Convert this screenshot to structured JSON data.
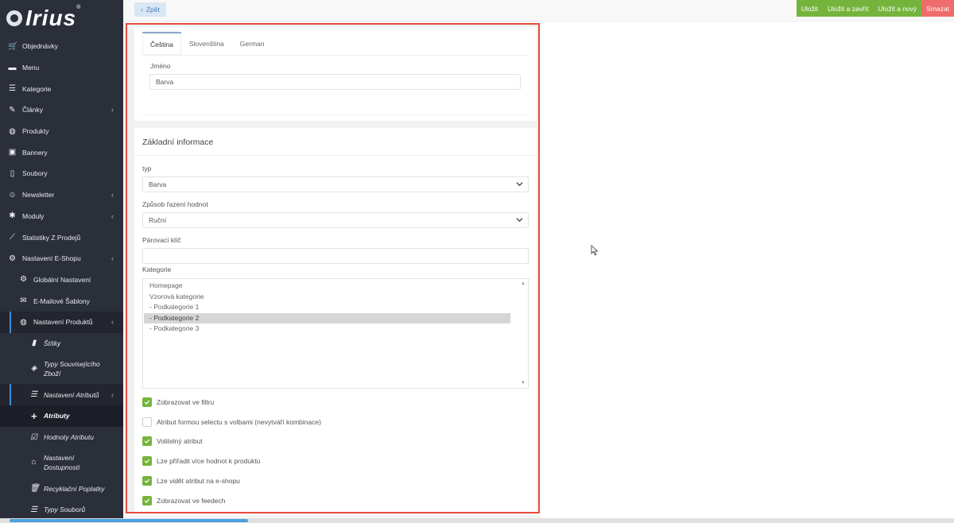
{
  "sidebar": {
    "logo": "Irius",
    "logo_reg": "®",
    "items": [
      {
        "label": "Objednávky",
        "icon": "cart-icon"
      },
      {
        "label": "Menu",
        "icon": "folder-icon"
      },
      {
        "label": "Kategorie",
        "icon": "list-icon"
      },
      {
        "label": "Články",
        "icon": "pencil-icon"
      },
      {
        "label": "Produkty",
        "icon": "dribbble-icon"
      },
      {
        "label": "Bannery",
        "icon": "image-icon"
      },
      {
        "label": "Soubory",
        "icon": "file-icon"
      },
      {
        "label": "Newsletter",
        "icon": "envelope-icon"
      },
      {
        "label": "Moduly",
        "icon": "puzzle-icon"
      },
      {
        "label": "Statistiky Z Prodejů",
        "icon": "chart-icon"
      },
      {
        "label": "Nastavení E-Shopu",
        "icon": "cogs-icon"
      },
      {
        "label": "Globální Nastavení",
        "icon": "gear-icon"
      },
      {
        "label": "E-Mailové Šablony",
        "icon": "mail-icon"
      },
      {
        "label": "Nastavení Produktů",
        "icon": "dribbble-icon"
      },
      {
        "label": "Štítky",
        "icon": "bookmark-icon"
      },
      {
        "label": "Typy Souvisejícího Zboží",
        "icon": "layers-icon"
      },
      {
        "label": "Nastavení Atributů",
        "icon": "sliders-icon"
      },
      {
        "label": "Atributy",
        "icon": "plus-icon"
      },
      {
        "label": "Hodnoty Atributu",
        "icon": "checkbox-icon"
      },
      {
        "label": "Nastavení Dostupností",
        "icon": "home-icon"
      },
      {
        "label": "Recyklační Poplatky",
        "icon": "trash-icon"
      },
      {
        "label": "Typy Souborů",
        "icon": "list-icon"
      }
    ]
  },
  "topbar": {
    "back_label": "Zpět",
    "save_label": "Uložit",
    "save_close_label": "Uložit a zavřít",
    "save_new_label": "Uložit a nový",
    "delete_label": "Smazat",
    "colors": {
      "green": "#74b43c",
      "red": "#ef6c6c"
    }
  },
  "language_tabs": [
    "Čeština",
    "Slovenština",
    "German"
  ],
  "name_section": {
    "label": "Jméno",
    "value": "Barva"
  },
  "basic_info": {
    "title": "Základní informace",
    "type_label": "typ",
    "type_value": "Barva",
    "sort_label": "Způsob řazení hodnot",
    "sort_value": "Ruční",
    "pairing_key_label": "Párovací klíč",
    "pairing_key_value": "",
    "category_label": "Kategorie",
    "categories": [
      "Homepage",
      "Vzorová kategorie",
      "- Podkategorie 1",
      "- Podkategorie 2",
      "- Podkategorie 3"
    ],
    "selected_category": "- Podkategorie 2",
    "checkboxes": [
      {
        "label": "Zobrazovat ve filtru",
        "checked": true
      },
      {
        "label": "Atribut formou selectu s volbami (nevytváří kombinace)",
        "checked": false
      },
      {
        "label": "Volitelný atribut",
        "checked": true
      },
      {
        "label": "Lze přiřadit více hodnot k produktu",
        "checked": true
      },
      {
        "label": "Lze vidět atribut na e-shopu",
        "checked": true
      },
      {
        "label": "Zobrazovat ve feedech",
        "checked": true
      }
    ]
  }
}
